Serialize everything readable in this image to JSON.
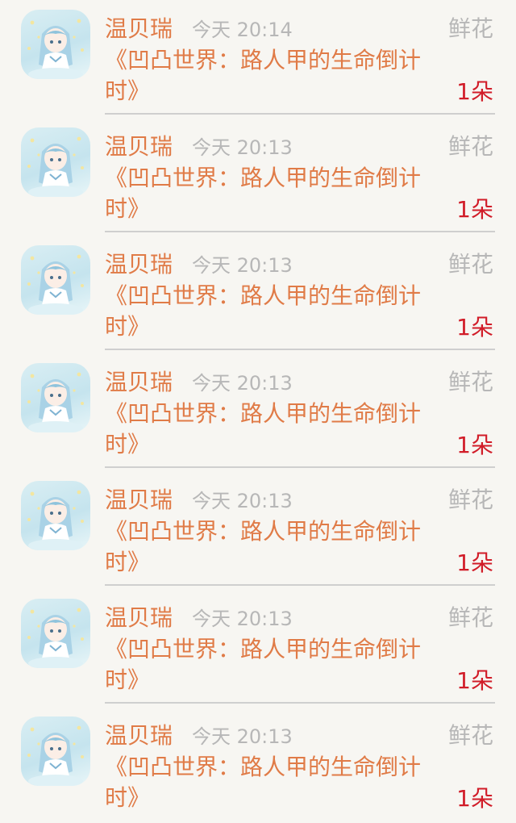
{
  "items": [
    {
      "name": "温贝瑞",
      "time": "今天 20:14",
      "type": "鲜花",
      "book": "《凹凸世界：路人甲的生命倒计时》",
      "count": "1朵"
    },
    {
      "name": "温贝瑞",
      "time": "今天 20:13",
      "type": "鲜花",
      "book": "《凹凸世界：路人甲的生命倒计时》",
      "count": "1朵"
    },
    {
      "name": "温贝瑞",
      "time": "今天 20:13",
      "type": "鲜花",
      "book": "《凹凸世界：路人甲的生命倒计时》",
      "count": "1朵"
    },
    {
      "name": "温贝瑞",
      "time": "今天 20:13",
      "type": "鲜花",
      "book": "《凹凸世界：路人甲的生命倒计时》",
      "count": "1朵"
    },
    {
      "name": "温贝瑞",
      "time": "今天 20:13",
      "type": "鲜花",
      "book": "《凹凸世界：路人甲的生命倒计时》",
      "count": "1朵"
    },
    {
      "name": "温贝瑞",
      "time": "今天 20:13",
      "type": "鲜花",
      "book": "《凹凸世界：路人甲的生命倒计时》",
      "count": "1朵"
    },
    {
      "name": "温贝瑞",
      "time": "今天 20:13",
      "type": "鲜花",
      "book": "《凹凸世界：路人甲的生命倒计时》",
      "count": "1朵"
    }
  ],
  "avatar_icon": "anime-girl-avatar-icon",
  "colors": {
    "accent": "#e07b47",
    "muted": "#b7b7b7",
    "count": "#d11c28",
    "background": "#f7f6f2",
    "divider": "#cfcfcf"
  }
}
